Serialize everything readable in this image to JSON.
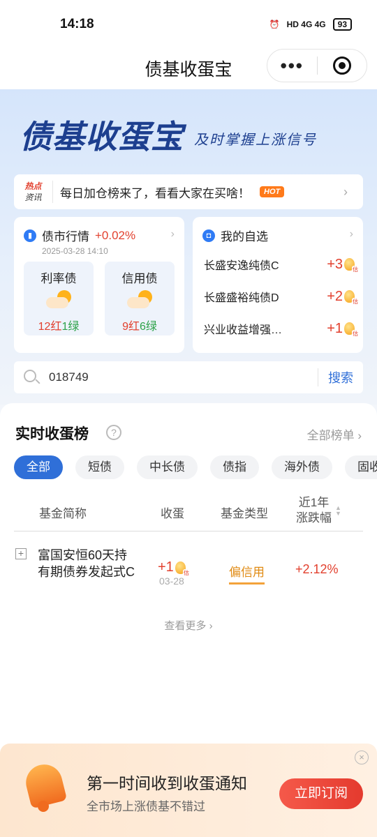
{
  "status": {
    "time": "14:18",
    "network": "HD 4G 4G",
    "battery": "93"
  },
  "nav": {
    "title": "债基收蛋宝"
  },
  "hero": {
    "brand": "债基收蛋宝",
    "slogan": "及时掌握上涨信号"
  },
  "hotbar": {
    "tag1": "热点",
    "tag2": "资讯",
    "message": "每日加仓榜来了，看看大家在买啥！",
    "badge": "HOT"
  },
  "market": {
    "title": "债市行情",
    "change": "+0.02%",
    "date": "2025-03-28 14:10",
    "boxes": [
      {
        "name": "利率债",
        "red": "12红",
        "green": "1绿"
      },
      {
        "name": "信用债",
        "red": "9红",
        "green": "6绿"
      }
    ]
  },
  "watchlist": {
    "title": "我的自选",
    "items": [
      {
        "name": "长盛安逸纯债C",
        "value": "+3",
        "badge": "估"
      },
      {
        "name": "长盛盛裕纯债D",
        "value": "+2",
        "badge": "估"
      },
      {
        "name": "兴业收益增强…",
        "value": "+1",
        "badge": "估"
      }
    ]
  },
  "search": {
    "query": "018749",
    "button": "搜索"
  },
  "ranking": {
    "title": "实时收蛋榜",
    "all_label": "全部榜单",
    "tabs": [
      "全部",
      "短债",
      "中长债",
      "债指",
      "海外债",
      "固收"
    ],
    "active_tab": 0,
    "columns": {
      "name": "基金简称",
      "egg": "收蛋",
      "type": "基金类型",
      "change_line1": "近1年",
      "change_line2": "涨跌幅"
    },
    "rows": [
      {
        "name": "富国安恒60天持有期债券发起式C",
        "egg": "+1",
        "egg_badge": "估",
        "date": "03-28",
        "type": "偏信用",
        "change": "+2.12%"
      }
    ],
    "see_more": "查看更多"
  },
  "banner": {
    "title": "第一时间收到收蛋通知",
    "subtitle": "全市场上涨债基不错过",
    "button": "立即订阅"
  },
  "colors": {
    "primary": "#2f6fd8",
    "up": "#e2402e",
    "down": "#2ea24a",
    "accent": "#f3a23a"
  }
}
